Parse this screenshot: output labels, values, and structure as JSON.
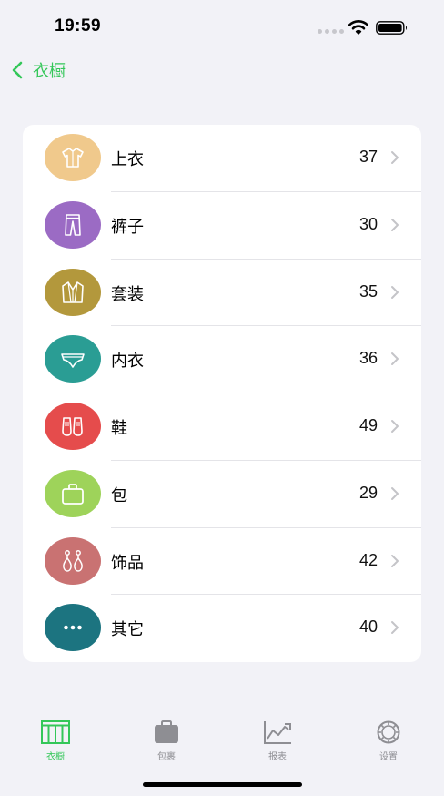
{
  "status_bar": {
    "time": "19:59"
  },
  "nav": {
    "back_label": "衣橱",
    "accent_color": "#34c759"
  },
  "categories": [
    {
      "label": "上衣",
      "count": "37",
      "icon": "shirt-icon",
      "color": "#f0c98c"
    },
    {
      "label": "裤子",
      "count": "30",
      "icon": "pants-icon",
      "color": "#9b6bc4"
    },
    {
      "label": "套装",
      "count": "35",
      "icon": "suit-icon",
      "color": "#b3983c"
    },
    {
      "label": "内衣",
      "count": "36",
      "icon": "underwear-icon",
      "color": "#2a9d94"
    },
    {
      "label": "鞋",
      "count": "49",
      "icon": "shoes-icon",
      "color": "#e54c4c"
    },
    {
      "label": "包",
      "count": "29",
      "icon": "bag-icon",
      "color": "#9ed35a"
    },
    {
      "label": "饰品",
      "count": "42",
      "icon": "earrings-icon",
      "color": "#c97272"
    },
    {
      "label": "其它",
      "count": "40",
      "icon": "more-icon",
      "color": "#1c7480"
    }
  ],
  "tabs": [
    {
      "label": "衣橱",
      "icon": "wardrobe-icon",
      "active": true
    },
    {
      "label": "包裹",
      "icon": "package-icon",
      "active": false
    },
    {
      "label": "报表",
      "icon": "chart-icon",
      "active": false
    },
    {
      "label": "设置",
      "icon": "settings-icon",
      "active": false
    }
  ]
}
